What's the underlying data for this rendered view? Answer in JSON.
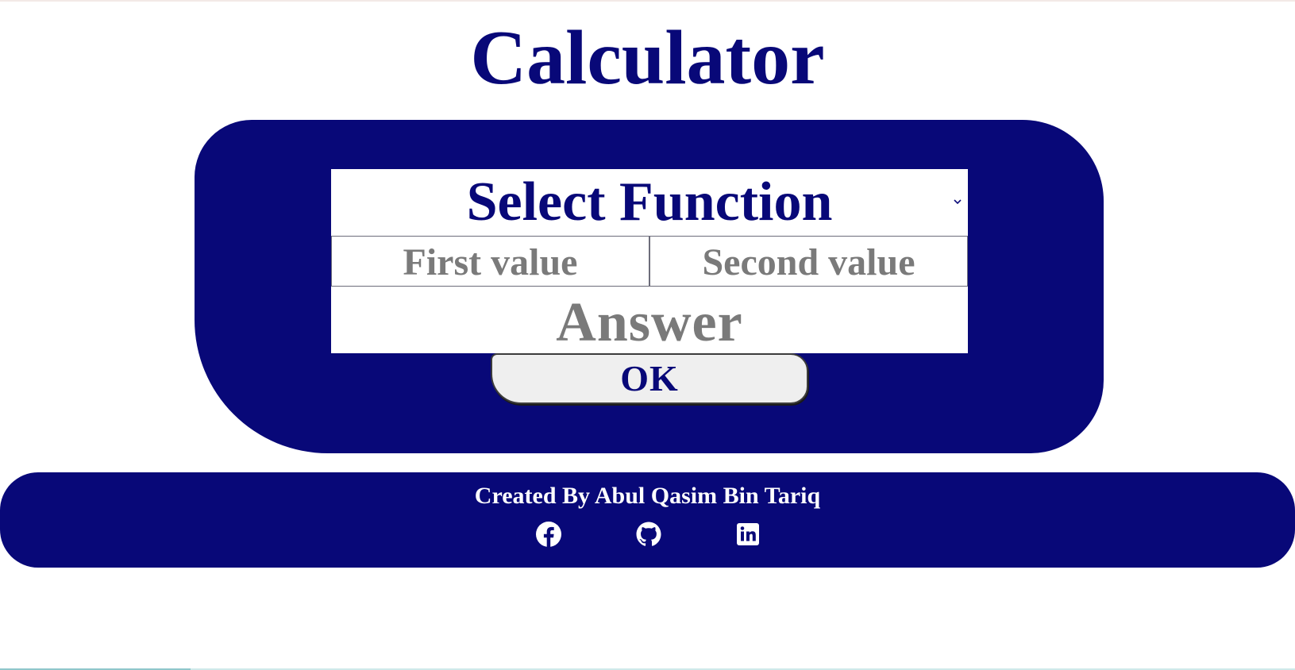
{
  "page": {
    "title": "Calculator"
  },
  "calculator": {
    "function_select": {
      "selected": "Select Function"
    },
    "first_value": {
      "placeholder": "First value"
    },
    "second_value": {
      "placeholder": "Second value"
    },
    "answer": {
      "placeholder": "Answer"
    },
    "ok_button": {
      "label": "OK"
    }
  },
  "footer": {
    "credit": "Created By Abul Qasim Bin Tariq",
    "social": [
      {
        "icon": "facebook-icon"
      },
      {
        "icon": "github-icon"
      },
      {
        "icon": "linkedin-icon"
      }
    ]
  },
  "colors": {
    "brand": "#080878",
    "placeholder": "#7a7a7a",
    "button_bg": "#efefef",
    "background": "#ffffff"
  }
}
